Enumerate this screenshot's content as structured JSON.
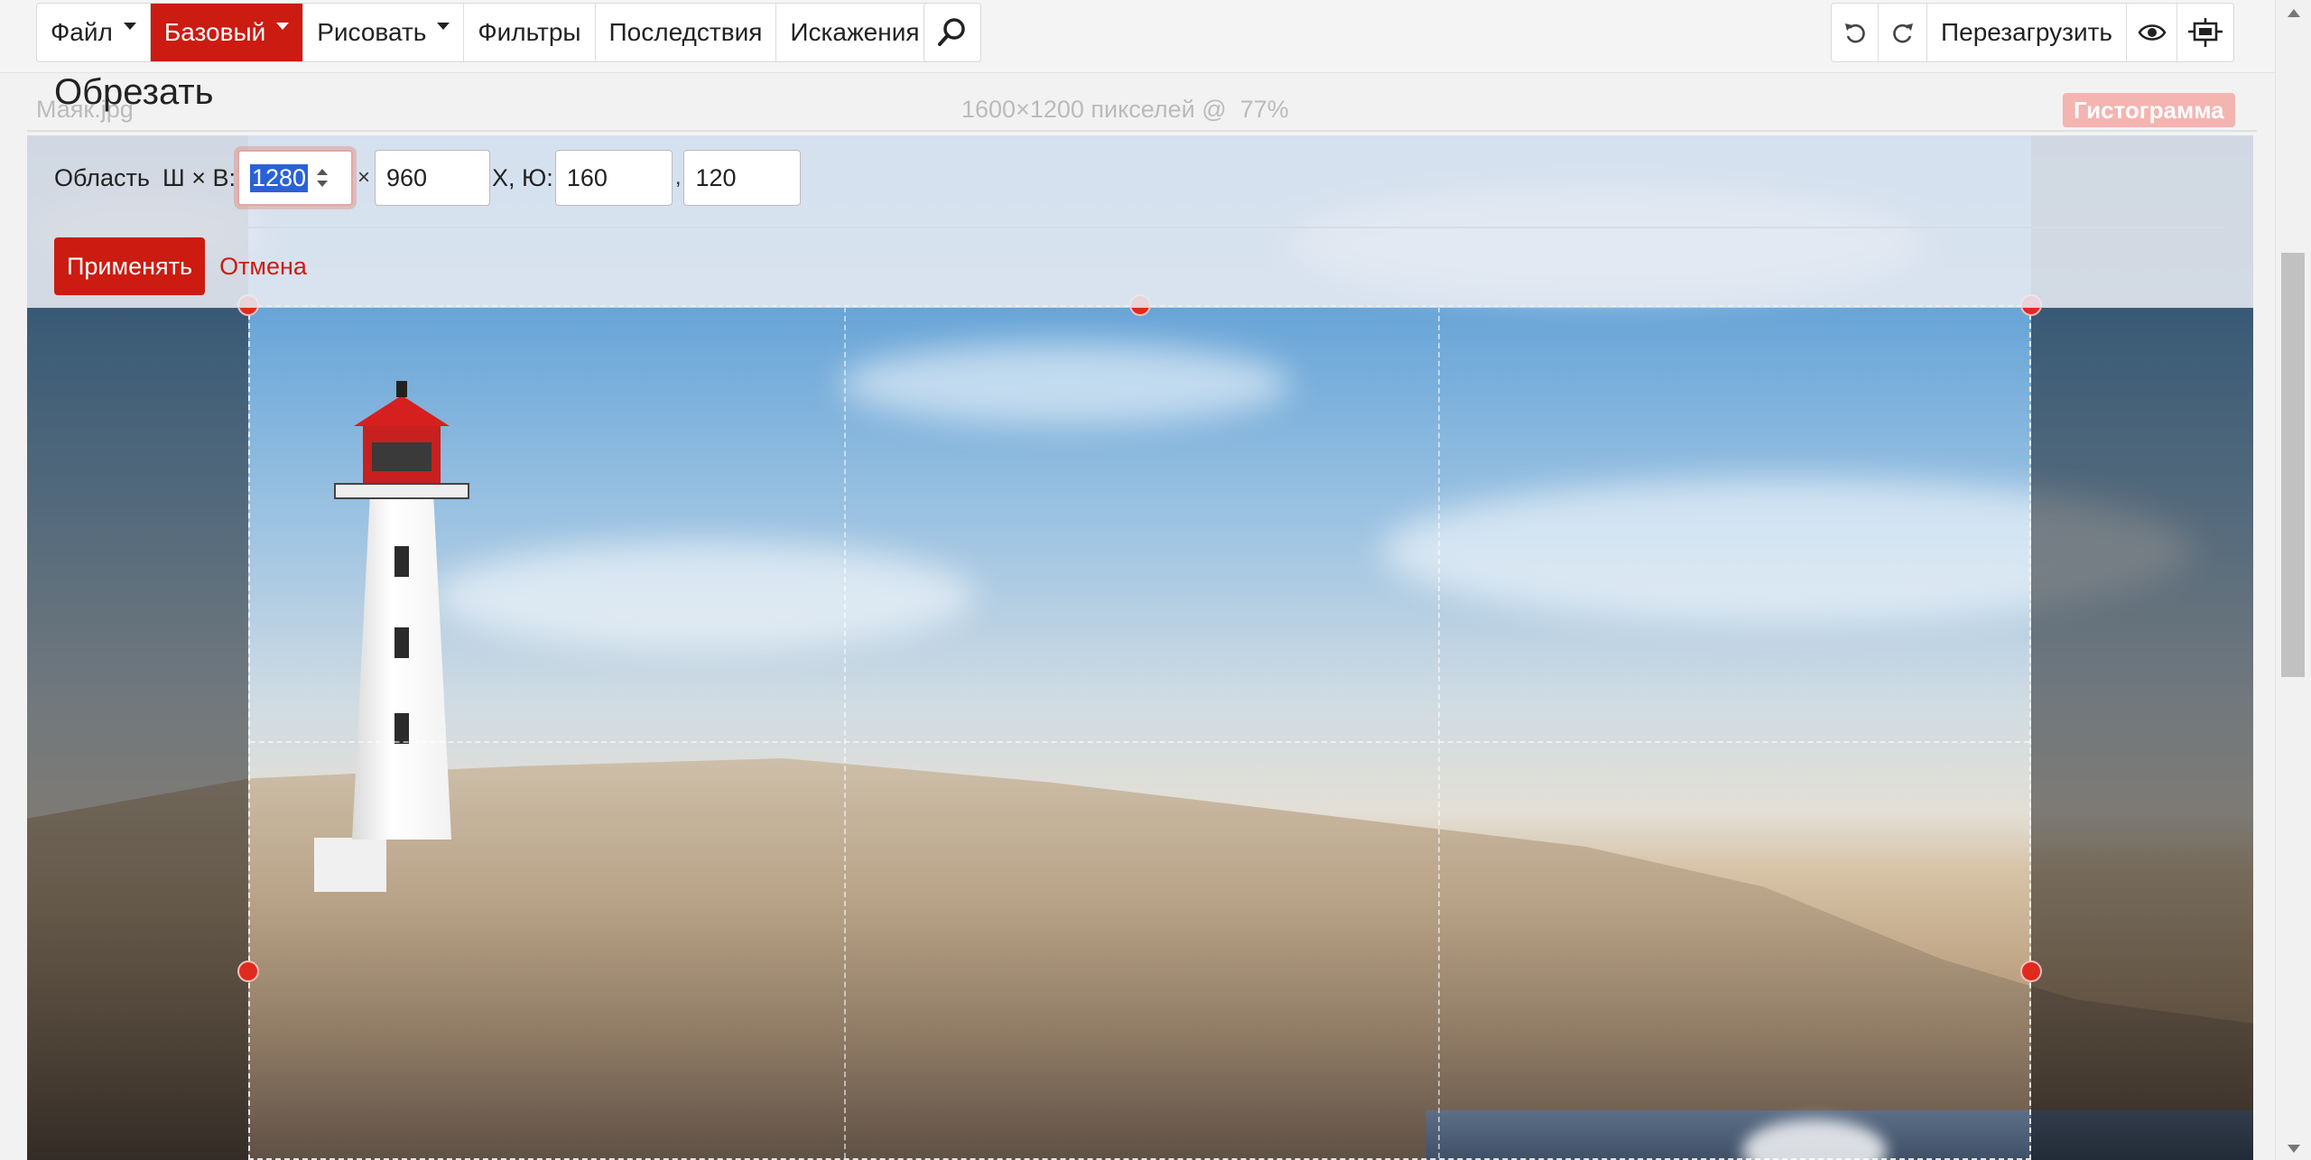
{
  "menu": {
    "items": [
      {
        "label": "Файл",
        "caret": true
      },
      {
        "label": "Базовый",
        "caret": true,
        "active": true
      },
      {
        "label": "Рисовать",
        "caret": true
      },
      {
        "label": "Фильтры"
      },
      {
        "label": "Последствия"
      },
      {
        "label": "Искажения"
      }
    ],
    "search_icon": "search-icon",
    "right": {
      "undo_icon": "undo-icon",
      "redo_icon": "redo-icon",
      "reload_label": "Перезагрузить",
      "eye_icon": "eye-icon",
      "fit_icon": "fit-screen-icon"
    }
  },
  "info": {
    "filename": "Маяк.jpg",
    "dimensions": "1600×1200 пикселей @",
    "zoom": "77%",
    "histogram_label": "Гистограмма"
  },
  "crop": {
    "title": "Обрезать",
    "area_label": "Область",
    "wh_label": "Ш × В:",
    "width": "1280",
    "times": "×",
    "height": "960",
    "xy_label": "X, Ю:",
    "x": "160",
    "comma": ",",
    "y": "120",
    "apply_label": "Применять",
    "cancel_label": "Отмена"
  },
  "colors": {
    "accent": "#cc1b11",
    "histogram_bg": "#f4b4b0",
    "selection": "#2a62d6"
  }
}
